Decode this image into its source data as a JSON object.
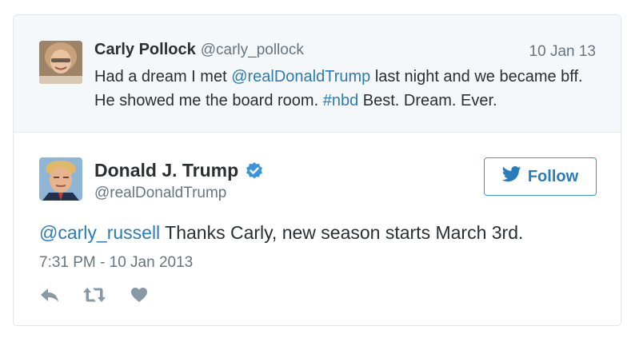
{
  "context_tweet": {
    "name": "Carly Pollock",
    "handle": "@carly_pollock",
    "date": "10 Jan 13",
    "text_before_mention": "Had a dream I met ",
    "mention": "@realDonaldTrump",
    "text_middle": " last night and we became bff. He showed me the board room. ",
    "hashtag": "#nbd",
    "text_after": " Best. Dream. Ever."
  },
  "main_tweet": {
    "name": "Donald J. Trump",
    "handle": "@realDonaldTrump",
    "verified": true,
    "follow_label": "Follow",
    "mention": "@carly_russell",
    "text": " Thanks Carly, new season starts March 3rd.",
    "timestamp": "7:31 PM - 10 Jan 2013"
  },
  "icons": {
    "reply": "reply-icon",
    "retweet": "retweet-icon",
    "like": "heart-icon",
    "follow": "twitter-bird-icon",
    "verified": "verified-badge-icon"
  },
  "colors": {
    "link": "#2b7bb9",
    "context_bg": "#f5f8fa",
    "border": "#e1e8ed",
    "muted": "#66757f",
    "verified": "#3b94d9"
  }
}
